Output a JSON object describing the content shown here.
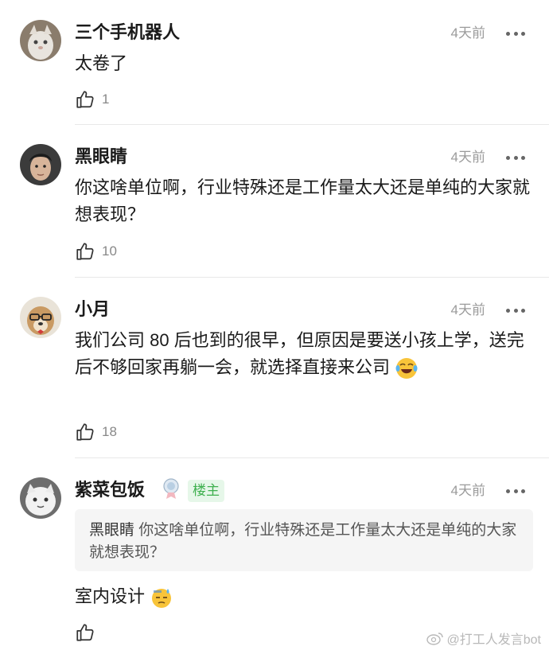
{
  "comments": [
    {
      "username": "三个手机器人",
      "time": "4天前",
      "text": "太卷了",
      "likes": "1"
    },
    {
      "username": "黑眼睛",
      "time": "4天前",
      "text": "你这啥单位啊，行业特殊还是工作量太大还是单纯的大家就想表现？",
      "likes": "10"
    },
    {
      "username": "小月",
      "time": "4天前",
      "text": "我们公司 80 后也到的很早，但原因是要送小孩上学，送完后不够回家再躺一会，就选择直接来公司",
      "likes": "18"
    },
    {
      "username": "紫菜包饭",
      "time": "4天前",
      "op_badge": "楼主",
      "quote_name": "黑眼睛",
      "quote_text": "你这啥单位啊，行业特殊还是工作量太大还是单纯的大家就想表现？",
      "text": "室内设计",
      "likes": ""
    }
  ],
  "watermark": "@打工人发言bot",
  "icons": {
    "like": "thumbs-up-icon",
    "more": "more-dots-icon",
    "emoji_laugh": "tears-of-joy-emoji",
    "emoji_sweat": "sweat-emoji",
    "watermark": "weibo-icon"
  },
  "colors": {
    "op_badge_bg": "#e6f7e9",
    "op_badge_text": "#3fb04f",
    "time": "#9b9b9b"
  }
}
